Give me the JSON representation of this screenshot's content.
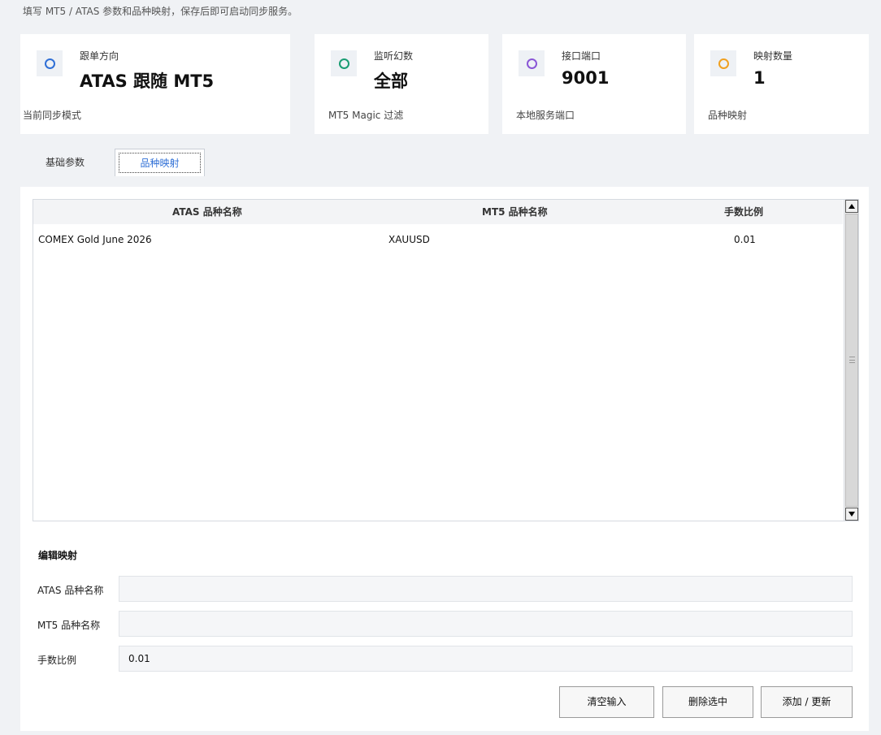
{
  "subtitle": "填写 MT5 / ATAS 参数和品种映射，保存后即可启动同步服务。",
  "cards": [
    {
      "label": "跟单方向",
      "value": "ATAS 跟随 MT5",
      "foot": "当前同步模式",
      "icon": "ring-icon",
      "color": "#2f6fd6"
    },
    {
      "label": "监听幻数",
      "value": "全部",
      "foot": "MT5 Magic 过滤",
      "icon": "ring-icon",
      "color": "#1a9c73"
    },
    {
      "label": "接口端口",
      "value": "9001",
      "foot": "本地服务端口",
      "icon": "ring-icon",
      "color": "#8a56d6"
    },
    {
      "label": "映射数量",
      "value": "1",
      "foot": "品种映射",
      "icon": "ring-icon",
      "color": "#f0a020"
    }
  ],
  "tabs": {
    "basic": "基础参数",
    "mapping": "品种映射"
  },
  "grid": {
    "columns": [
      "ATAS 品种名称",
      "MT5 品种名称",
      "手数比例"
    ],
    "rows": [
      [
        "COMEX Gold June 2026",
        "XAUUSD",
        "0.01"
      ]
    ]
  },
  "edit": {
    "title": "编辑映射",
    "atas_label": "ATAS 品种名称",
    "atas_value": "",
    "mt5_label": "MT5 品种名称",
    "mt5_value": "",
    "ratio_label": "手数比例",
    "ratio_value": "0.01"
  },
  "buttons": {
    "clear": "清空输入",
    "delete": "删除选中",
    "add": "添加 / 更新"
  }
}
